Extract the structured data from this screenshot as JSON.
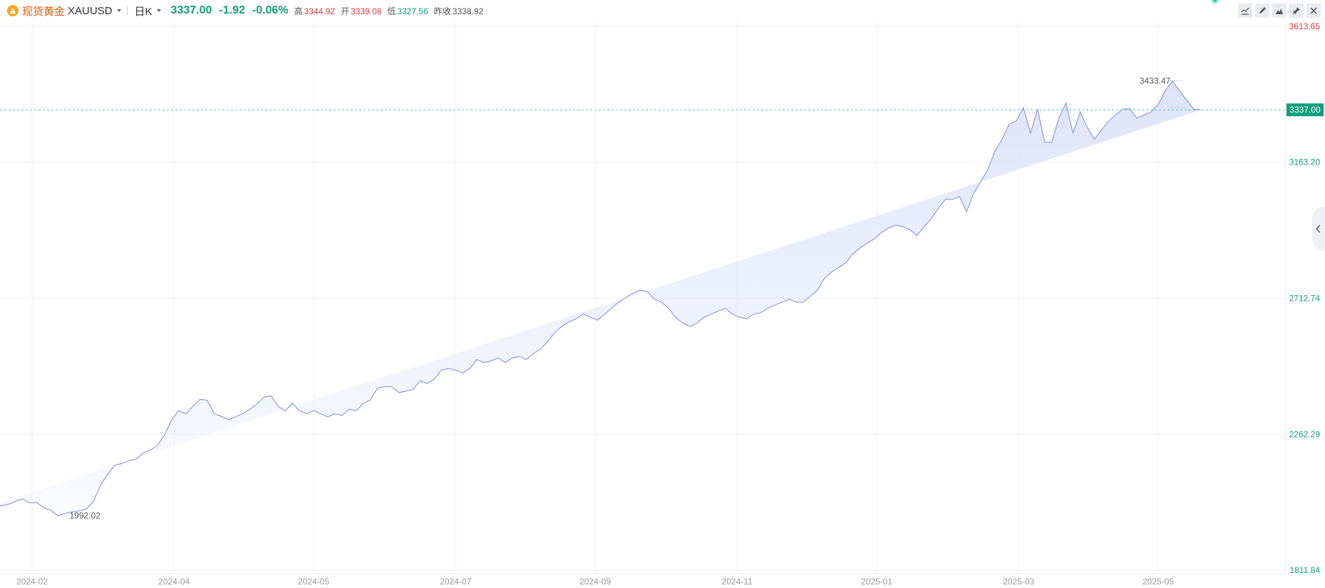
{
  "header": {
    "name": "现货黄金",
    "symbol": "XAUUSD",
    "period": "日K",
    "price": "3337.00",
    "change": "-1.92",
    "change_pct": "-0.06%",
    "high_label": "高",
    "high": "3344.92",
    "open_label": "开",
    "open": "3339.08",
    "low_label": "低",
    "low": "3327.56",
    "prev_label": "昨收",
    "prev": "3338.92"
  },
  "toolbar": {
    "icons": [
      "indicator-icon",
      "draw-icon",
      "chart-type-icon",
      "pin-icon",
      "close-icon"
    ]
  },
  "colors": {
    "up": "#e0383e",
    "down": "#12a07d",
    "line": "#7d8bd1",
    "fill": "#dfe4fb",
    "accent": "#12a07d"
  },
  "chart_data": {
    "type": "area",
    "y_ticks": [
      {
        "value": 3613.65,
        "label": "3613.65",
        "color": "#e0383e"
      },
      {
        "value": 3163.2,
        "label": "3163.20",
        "color": "#12a07d"
      },
      {
        "value": 2712.74,
        "label": "2712.74",
        "color": "#12a07d"
      },
      {
        "value": 2262.29,
        "label": "2262.29",
        "color": "#12a07d"
      },
      {
        "value": 1811.84,
        "label": "1811.84",
        "color": "#12a07d"
      }
    ],
    "ylim": [
      1811.84,
      3613.65
    ],
    "x_ticks": [
      {
        "date": "2024-02-01",
        "label": "2024-02"
      },
      {
        "date": "2024-04-01",
        "label": "2024-04"
      },
      {
        "date": "2024-05-30",
        "label": "2024-05"
      },
      {
        "date": "2024-07-29",
        "label": "2024-07"
      },
      {
        "date": "2024-09-26",
        "label": "2024-09"
      },
      {
        "date": "2024-11-25",
        "label": "2024-11"
      },
      {
        "date": "2025-01-23",
        "label": "2025-01"
      },
      {
        "date": "2025-03-24",
        "label": "2025-03"
      },
      {
        "date": "2025-05-22",
        "label": "2025-05"
      }
    ],
    "x": [
      "2024-01-16",
      "2024-01-19",
      "2024-01-22",
      "2024-01-25",
      "2024-01-28",
      "2024-01-31",
      "2024-02-03",
      "2024-02-06",
      "2024-02-09",
      "2024-02-12",
      "2024-02-15",
      "2024-02-18",
      "2024-02-21",
      "2024-02-24",
      "2024-02-27",
      "2024-03-01",
      "2024-03-04",
      "2024-03-07",
      "2024-03-10",
      "2024-03-13",
      "2024-03-16",
      "2024-03-19",
      "2024-03-22",
      "2024-03-25",
      "2024-03-28",
      "2024-03-31",
      "2024-04-03",
      "2024-04-06",
      "2024-04-09",
      "2024-04-12",
      "2024-04-15",
      "2024-04-18",
      "2024-04-21",
      "2024-04-24",
      "2024-04-27",
      "2024-04-30",
      "2024-05-03",
      "2024-05-06",
      "2024-05-09",
      "2024-05-12",
      "2024-05-15",
      "2024-05-18",
      "2024-05-21",
      "2024-05-24",
      "2024-05-27",
      "2024-05-30",
      "2024-06-02",
      "2024-06-05",
      "2024-06-08",
      "2024-06-11",
      "2024-06-14",
      "2024-06-17",
      "2024-06-20",
      "2024-06-23",
      "2024-06-26",
      "2024-06-29",
      "2024-07-02",
      "2024-07-05",
      "2024-07-08",
      "2024-07-11",
      "2024-07-14",
      "2024-07-17",
      "2024-07-20",
      "2024-07-23",
      "2024-07-26",
      "2024-07-29",
      "2024-08-01",
      "2024-08-04",
      "2024-08-07",
      "2024-08-10",
      "2024-08-13",
      "2024-08-16",
      "2024-08-19",
      "2024-08-22",
      "2024-08-25",
      "2024-08-28",
      "2024-08-31",
      "2024-09-03",
      "2024-09-06",
      "2024-09-09",
      "2024-09-12",
      "2024-09-15",
      "2024-09-18",
      "2024-09-21",
      "2024-09-24",
      "2024-09-27",
      "2024-09-30",
      "2024-10-03",
      "2024-10-06",
      "2024-10-09",
      "2024-10-12",
      "2024-10-15",
      "2024-10-18",
      "2024-10-21",
      "2024-10-24",
      "2024-10-27",
      "2024-10-30",
      "2024-11-02",
      "2024-11-05",
      "2024-11-08",
      "2024-11-11",
      "2024-11-14",
      "2024-11-17",
      "2024-11-20",
      "2024-11-23",
      "2024-11-26",
      "2024-11-29",
      "2024-12-02",
      "2024-12-05",
      "2024-12-08",
      "2024-12-11",
      "2024-12-14",
      "2024-12-17",
      "2024-12-20",
      "2024-12-23",
      "2024-12-26",
      "2024-12-29",
      "2025-01-01",
      "2025-01-04",
      "2025-01-07",
      "2025-01-10",
      "2025-01-13",
      "2025-01-16",
      "2025-01-19",
      "2025-01-22",
      "2025-01-25",
      "2025-01-28",
      "2025-01-31",
      "2025-02-03",
      "2025-02-06",
      "2025-02-09",
      "2025-02-12",
      "2025-02-15",
      "2025-02-18",
      "2025-02-21",
      "2025-02-24",
      "2025-02-27",
      "2025-03-02",
      "2025-03-05",
      "2025-03-08",
      "2025-03-11",
      "2025-03-14",
      "2025-03-17",
      "2025-03-20",
      "2025-03-23",
      "2025-03-26",
      "2025-03-29",
      "2025-04-01",
      "2025-04-04",
      "2025-04-07",
      "2025-04-10",
      "2025-04-13",
      "2025-04-16",
      "2025-04-19",
      "2025-04-22",
      "2025-04-25",
      "2025-04-28",
      "2025-05-01",
      "2025-05-04",
      "2025-05-07",
      "2025-05-10",
      "2025-05-13",
      "2025-05-16",
      "2025-05-19",
      "2025-05-22",
      "2025-05-25",
      "2025-05-28",
      "2025-05-31",
      "2025-06-03",
      "2025-06-06",
      "2025-06-09",
      "2025-06-12",
      "2025-06-15"
    ],
    "values": [
      2030,
      2025,
      2030,
      2040,
      2048,
      2035,
      2036,
      2018,
      2010,
      1992,
      2000,
      2005,
      2008,
      2015,
      2040,
      2095,
      2130,
      2160,
      2165,
      2175,
      2180,
      2200,
      2210,
      2225,
      2260,
      2310,
      2340,
      2330,
      2355,
      2378,
      2375,
      2330,
      2322,
      2310,
      2320,
      2330,
      2345,
      2362,
      2385,
      2390,
      2355,
      2340,
      2365,
      2340,
      2330,
      2340,
      2330,
      2320,
      2330,
      2325,
      2345,
      2340,
      2365,
      2375,
      2415,
      2420,
      2420,
      2400,
      2405,
      2410,
      2440,
      2430,
      2445,
      2475,
      2480,
      2475,
      2465,
      2480,
      2510,
      2500,
      2505,
      2515,
      2500,
      2515,
      2520,
      2510,
      2530,
      2545,
      2570,
      2600,
      2620,
      2635,
      2645,
      2660,
      2650,
      2640,
      2660,
      2680,
      2700,
      2715,
      2730,
      2740,
      2735,
      2710,
      2700,
      2680,
      2650,
      2630,
      2620,
      2630,
      2650,
      2660,
      2670,
      2680,
      2660,
      2650,
      2645,
      2660,
      2665,
      2680,
      2690,
      2700,
      2710,
      2700,
      2700,
      2720,
      2740,
      2780,
      2800,
      2815,
      2830,
      2860,
      2880,
      2895,
      2910,
      2930,
      2945,
      2955,
      2950,
      2940,
      2920,
      2950,
      2975,
      3010,
      3040,
      3040,
      3050,
      3000,
      3060,
      3100,
      3140,
      3200,
      3240,
      3290,
      3300,
      3345,
      3260,
      3340,
      3230,
      3230,
      3310,
      3360,
      3260,
      3330,
      3280,
      3240,
      3270,
      3300,
      3320,
      3340,
      3340,
      3310,
      3320,
      3330,
      3355,
      3400,
      3433,
      3400,
      3370,
      3340,
      3337
    ],
    "current": {
      "value": 3337.0,
      "label": "3337.00"
    },
    "annotations": [
      {
        "label": "3433.47",
        "value": 3433.47,
        "date": "2025-06-01",
        "side": "left"
      },
      {
        "label": "1992.02",
        "value": 1992.02,
        "date": "2024-02-12",
        "side": "right"
      }
    ]
  }
}
